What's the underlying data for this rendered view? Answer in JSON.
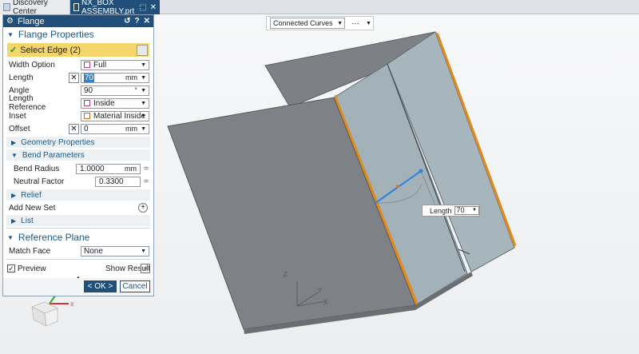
{
  "tabs": [
    {
      "label": "Discovery Center"
    },
    {
      "label": "NX_BOX ASSEMBLY.prt",
      "pin": "⬚",
      "close": "✕"
    }
  ],
  "selection_toolbar": {
    "filter_value": "Connected Curves",
    "more": "···"
  },
  "dialog": {
    "title": "Flange",
    "header_buttons": [
      "↺",
      "?",
      "✕"
    ],
    "flange_properties": {
      "heading": "Flange Properties",
      "select_edge": "Select Edge (2)",
      "width_option": {
        "label": "Width Option",
        "value": "Full"
      },
      "length": {
        "label": "Length",
        "value": "70",
        "unit": "mm"
      },
      "angle": {
        "label": "Angle",
        "value": "90",
        "unit": "°"
      },
      "length_reference": {
        "label": "Length Reference",
        "value": "Inside"
      },
      "inset": {
        "label": "Inset",
        "value": "Material Inside"
      },
      "offset": {
        "label": "Offset",
        "value": "0",
        "unit": "mm"
      }
    },
    "geometry_properties": "Geometry Properties",
    "bend_parameters": {
      "heading": "Bend Parameters",
      "bend_radius": {
        "label": "Bend Radius",
        "value": "1.0000",
        "unit": "mm"
      },
      "neutral_factor": {
        "label": "Neutral Factor",
        "value": "0.3300"
      }
    },
    "relief": "Relief",
    "add_new_set": "Add New Set",
    "list": "List",
    "reference_plane": {
      "heading": "Reference Plane",
      "match_face": {
        "label": "Match Face",
        "value": "None"
      }
    },
    "preview": {
      "label": "Preview",
      "checked": true,
      "show_result": "Show Result"
    },
    "ok": "< OK >",
    "cancel": "Cancel"
  },
  "length_handle": {
    "label": "Length",
    "value": "70"
  },
  "triad": {
    "x": "X",
    "y": "Y",
    "z": "Z"
  },
  "view_triad": {
    "x": "X",
    "y": "Y",
    "z": "Z"
  },
  "colors": {
    "title_bar": "#1f4f7a",
    "accent": "#1a5a8a",
    "selected_step": "#f5d66a",
    "edge_highlight": "#e08a1c"
  },
  "icons": [
    "gear-icon",
    "reset-icon",
    "help-icon",
    "close-icon",
    "cube-icon",
    "check-icon",
    "plus-icon",
    "show-result-icon"
  ]
}
